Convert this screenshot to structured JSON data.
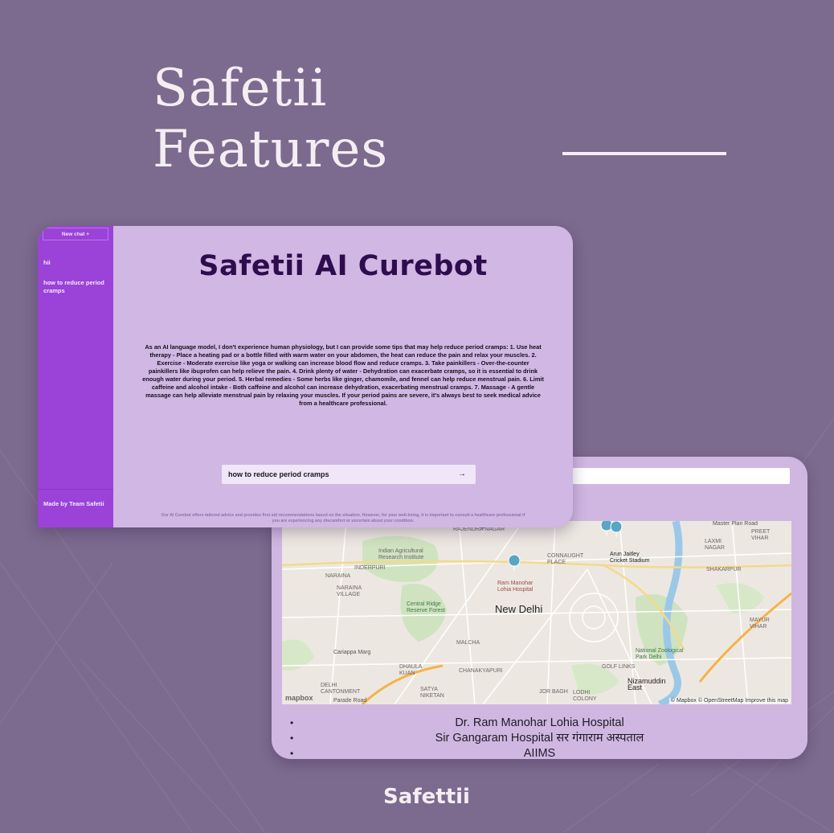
{
  "page": {
    "title_line1": "Safetii",
    "title_line2": "Features",
    "footer_brand": "Safettii",
    "colors": {
      "background": "#7d6a8f",
      "sidebar": "#9b42d8",
      "card": "#d1b7e4",
      "title": "#2e0c4e"
    }
  },
  "chat": {
    "new_chat_label": "New chat +",
    "history": [
      "hii",
      "how to reduce period cramps"
    ],
    "made_by": "Made by Team Safetii",
    "title": "Safetii AI Curebot",
    "answer": "As an AI language model, I don't experience human physiology, but I can provide some tips that may help reduce period cramps: 1. Use heat therapy - Place a heating pad or a bottle filled with warm water on your abdomen, the heat can reduce the pain and relax your muscles. 2. Exercise - Moderate exercise like yoga or walking can increase blood flow and reduce cramps. 3. Take painkillers - Over-the-counter painkillers like ibuprofen can help relieve the pain. 4. Drink plenty of water - Dehydration can exacerbate cramps, so it is essential to drink enough water during your period. 5. Herbal remedies - Some herbs like ginger, chamomile, and fennel can help reduce menstrual pain. 6. Limit caffeine and alcohol intake - Both caffeine and alcohol can increase dehydration, exacerbating menstrual cramps. 7. Massage - A gentle massage can help alleviate menstrual pain by relaxing your muscles. If your period pains are severe, it's always best to seek medical advice from a healthcare professional.",
    "input_value": "how to reduce period cramps",
    "send_icon": "→",
    "disclaimer": "Our AI Curebot offers tailored advice and provides first aid recommendations based on the situation. However, for your well-being, it is important to consult a healthcare professional if you are experiencing any discomfort or uncertain about your condition."
  },
  "map": {
    "city_label": "New Delhi",
    "labels": {
      "rajendra": "RAJENDRA NAGAR",
      "indian_agri": "Indian Agricultural Research Institute",
      "naraina": "NARAINA",
      "naraina_village": "NARAINA VILLAGE",
      "inderpuri": "INDERPURI",
      "central_ridge": "Central Ridge Reserve Forest",
      "connaught": "CONNAUGHT PLACE",
      "ram_manohar": "Ram Manohar Lohia Hospital",
      "arun_jaitley": "Arun Jaitley Cricket Stadium",
      "laxmi_nagar": "LAXMI NAGAR",
      "shakarpur": "SHAKARPUR",
      "preet_vihar": "PREET VIHAR",
      "mayur_vihar": "MAYUR VIHAR",
      "malcha": "MALCHA",
      "chanakyapuri": "CHANAKYAPURI",
      "dhaula_kuan": "DHAULA KUAN",
      "delhi_cantt": "DELHI CANTONMENT",
      "satya_niketan": "SATYA NIKETAN",
      "golf_links": "GOLF LINKS",
      "jor_bagh": "JOR BAGH",
      "lodhi": "LODHI COLONY",
      "zoo": "National Zoological Park Delhi",
      "nizamuddin": "Nizamuddin East",
      "master_plan": "Master Plan Road",
      "cariappa": "Cariappa Marg",
      "parade": "Parade Road"
    },
    "logo": "mapbox",
    "attribution": "© Mapbox © OpenStreetMap Improve this map",
    "hospitals": [
      "Dr. Ram Manohar Lohia Hospital",
      "Sir Gangaram Hospital सर गंगाराम अस्पताल",
      "AIIMS"
    ]
  }
}
